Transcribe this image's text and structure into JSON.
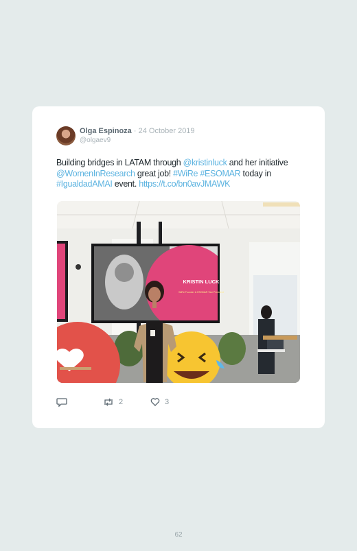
{
  "tweet": {
    "author_name": "Olga Espinoza",
    "separator": "·",
    "date": "24 October 2019",
    "handle": "@olgaev9",
    "text": {
      "t1": "Building bridges in LATAM through ",
      "mention1": "@kristinluck",
      "t2": " and her initiative ",
      "mention2": "@WomenInResearch",
      "t3": " great job! ",
      "hashtag1": "#WiRe",
      "t4": " ",
      "hashtag2": "#ESOMAR",
      "t5": " today in ",
      "hashtag3": "#IgualdadAMAI",
      "t6": " event. ",
      "url": "https://t.co/bn0avJMAWK"
    },
    "photo": {
      "screen_name": "KRISTIN LUCK",
      "screen_caption": "WIRe Founder & ESOMAR Vice President"
    },
    "actions": {
      "retweets": "2",
      "likes": "3"
    }
  },
  "colors": {
    "background": "#e4ebeb",
    "card": "#ffffff",
    "link": "#5cb3e0",
    "name": "#5a6770",
    "muted": "#a9b3b8"
  },
  "page": {
    "number": "62"
  }
}
